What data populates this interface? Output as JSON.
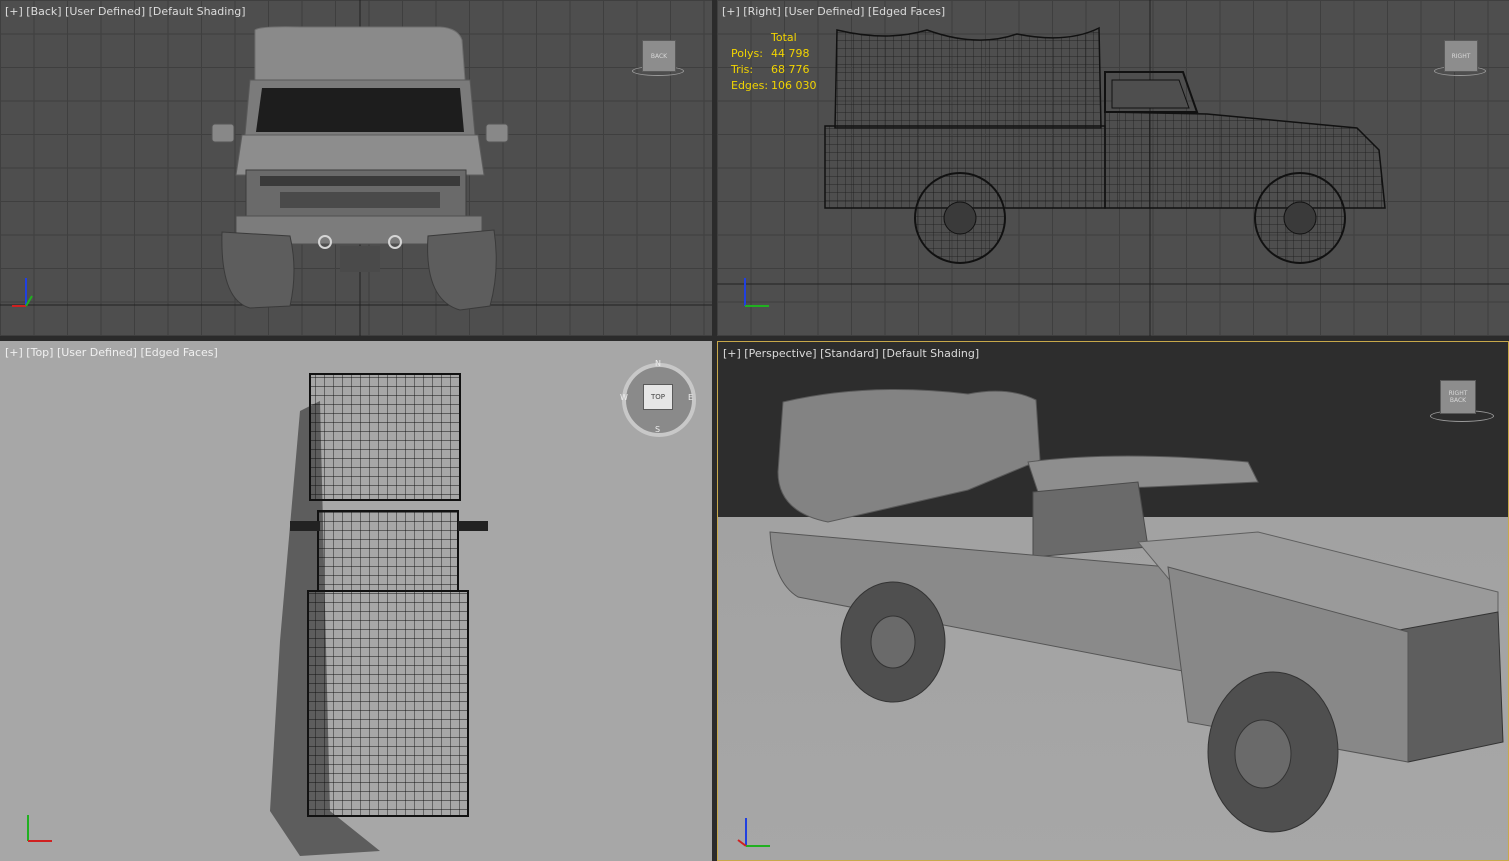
{
  "viewports": {
    "back": {
      "label": "[+] [Back] [User Defined] [Default Shading]",
      "cube_label": "BACK"
    },
    "right": {
      "label": "[+] [Right] [User Defined] [Edged Faces]",
      "cube_label": "RIGHT",
      "stats": {
        "header": "Total",
        "rows": [
          {
            "key": "Polys:",
            "value": "44 798"
          },
          {
            "key": "Tris:",
            "value": "68 776"
          },
          {
            "key": "Edges:",
            "value": "106 030"
          }
        ]
      }
    },
    "top": {
      "label": "[+] [Top] [User Defined] [Edged Faces]",
      "cube_label": "TOP",
      "compass": {
        "n": "N",
        "s": "S",
        "e": "E",
        "w": "W"
      }
    },
    "perspective": {
      "label": "[+] [Perspective] [Standard] [Default Shading]",
      "cube_label_left": "RIGHT",
      "cube_label_right": "BACK"
    }
  },
  "colors": {
    "active_border": "#c8a84a",
    "stats_text": "#f2d400",
    "axis_x": "#d02020",
    "axis_y": "#20b020",
    "axis_z": "#2040e0"
  }
}
